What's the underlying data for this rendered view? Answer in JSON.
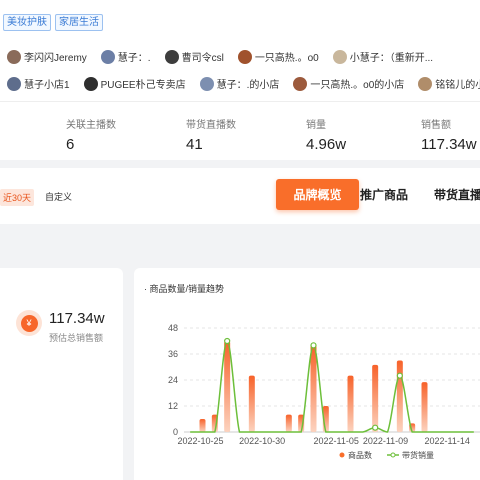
{
  "tags": [
    "美妆护肤",
    "家居生活"
  ],
  "anchors_row1": [
    {
      "name": "李闪闪Jeremy",
      "color": "#8a6b5a"
    },
    {
      "name": "慧子：.",
      "color": "#6c7fa6"
    },
    {
      "name": "曹司令csl",
      "color": "#3d3d3d"
    },
    {
      "name": "一只高热.。o0",
      "color": "#a0522d"
    },
    {
      "name": "小慧子：（重新开...",
      "color": "#c9b79c"
    }
  ],
  "anchors_row2": [
    {
      "name": "慧子小店1",
      "color": "#5e6d8c"
    },
    {
      "name": "PUGEE朴己专卖店",
      "color": "#2f2f2f"
    },
    {
      "name": "慧子：.的小店",
      "color": "#7d8fb0"
    },
    {
      "name": "一只高热.。o0的小店",
      "color": "#9c5a3c"
    },
    {
      "name": "铭铭儿的小店",
      "color": "#b08d6a"
    }
  ],
  "stats": [
    {
      "label": "关联主播数",
      "value": "6"
    },
    {
      "label": "带货直播数",
      "value": "41"
    },
    {
      "label": "销量",
      "value": "4.96w"
    },
    {
      "label": "销售额",
      "value": "117.34w"
    }
  ],
  "filter": {
    "range": "近30天",
    "custom": "自定义"
  },
  "tabs": [
    "品牌概览",
    "推广商品",
    "带货直播"
  ],
  "total": {
    "icon": "¥",
    "value": "117.34w",
    "label": "预估总销售额"
  },
  "chart_title": "· 商品数量/销量趋势",
  "colors": {
    "accent": "#f96e2a",
    "line": "#6dbf3a",
    "tag": "#3a7bd5"
  },
  "chart_data": {
    "type": "bar+line",
    "title": "商品数量/销量趋势",
    "x": [
      "10-24",
      "10-25",
      "10-26",
      "10-27",
      "10-28",
      "10-29",
      "10-30",
      "10-31",
      "11-01",
      "11-02",
      "11-03",
      "11-04",
      "11-05",
      "11-06",
      "11-07",
      "11-08",
      "11-09",
      "11-10",
      "11-11",
      "11-12",
      "11-13",
      "11-14",
      "11-15",
      "11-16"
    ],
    "x_tick_labels": [
      "2022-10-25",
      "2022-10-30",
      "2022-11-05",
      "2022-11-09",
      "2022-11-14"
    ],
    "ylim": [
      0,
      48
    ],
    "y_ticks": [
      0,
      12,
      24,
      36,
      48
    ],
    "series": [
      {
        "name": "商品数",
        "type": "bar",
        "values": [
          0,
          6,
          8,
          42,
          0,
          26,
          0,
          0,
          8,
          8,
          40,
          12,
          0,
          26,
          0,
          31,
          0,
          33,
          4,
          23,
          0,
          0,
          0,
          0
        ]
      },
      {
        "name": "带货销量",
        "type": "line",
        "values": [
          0,
          0,
          0,
          42,
          0,
          0,
          0,
          0,
          0,
          0,
          40,
          0,
          0,
          0,
          0,
          2,
          0,
          26,
          0,
          0,
          0,
          0,
          0,
          0
        ]
      }
    ],
    "legend": "bottom-right",
    "grid": true
  }
}
